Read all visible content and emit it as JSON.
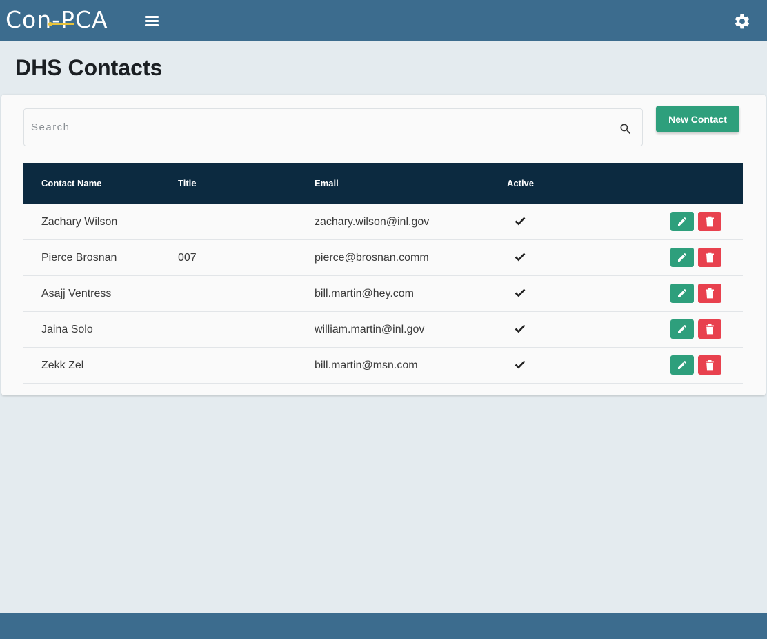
{
  "app": {
    "logo_text": "Con-PCA",
    "menu_icon": "hamburger-menu-icon",
    "settings_icon": "gear-icon"
  },
  "page": {
    "title": "DHS Contacts"
  },
  "search": {
    "placeholder": "Search",
    "value": ""
  },
  "actions": {
    "new_contact_label": "New Contact"
  },
  "table": {
    "headers": {
      "name": "Contact Name",
      "title": "Title",
      "email": "Email",
      "active": "Active"
    },
    "rows": [
      {
        "name": "Zachary Wilson",
        "title": "",
        "email": "zachary.wilson@inl.gov",
        "active": true
      },
      {
        "name": "Pierce Brosnan",
        "title": "007",
        "email": "pierce@brosnan.comm",
        "active": true
      },
      {
        "name": "Asajj Ventress",
        "title": "",
        "email": "bill.martin@hey.com",
        "active": true
      },
      {
        "name": "Jaina Solo",
        "title": "",
        "email": "william.martin@inl.gov",
        "active": true
      },
      {
        "name": "Zekk Zel",
        "title": "",
        "email": "bill.martin@msn.com",
        "active": true
      }
    ]
  },
  "colors": {
    "header_bar": "#3c6c8e",
    "table_header": "#0c2a40",
    "primary_green": "#2e9f7c",
    "danger_red": "#e8414e",
    "background": "#e4ebef"
  }
}
